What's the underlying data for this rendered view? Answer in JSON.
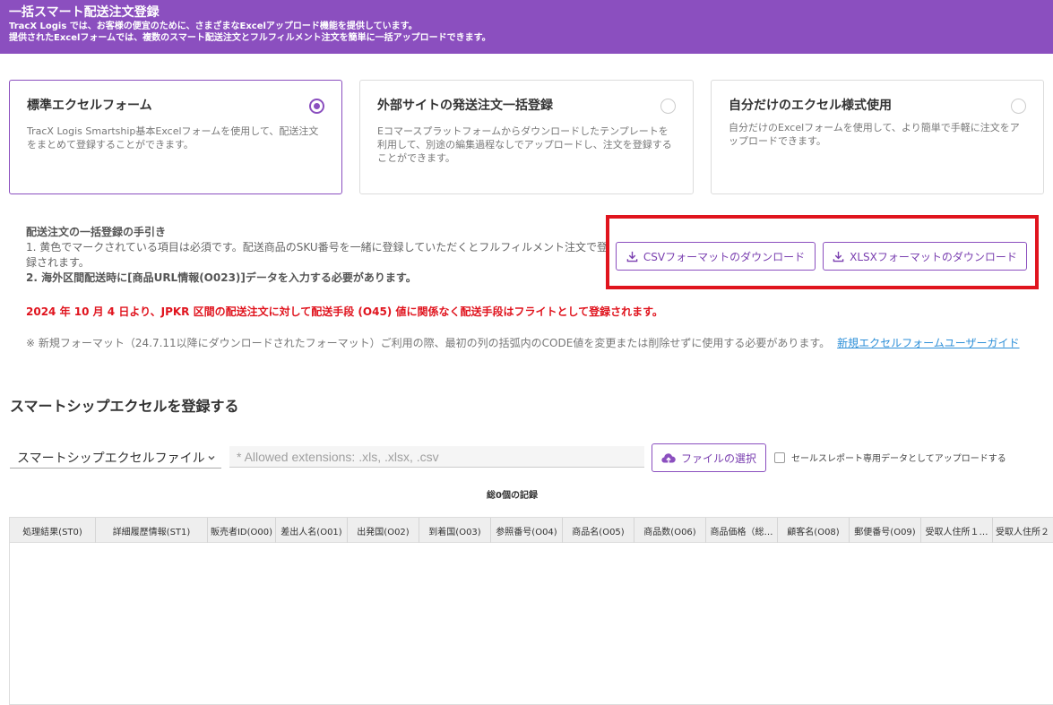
{
  "header": {
    "title": "一括スマート配送注文登録",
    "desc1": "TracX Logis では、お客様の便宜のために、さまざまなExcelアップロード機能を提供しています。",
    "desc2": "提供されたExcelフォームでは、複数のスマート配送注文とフルフィルメント注文を簡単に一括アップロードできます。"
  },
  "cards": [
    {
      "title": "標準エクセルフォーム",
      "desc": "TracX Logis Smartship基本Excelフォームを使用して、配送注文をまとめて登録することができます。",
      "selected": true
    },
    {
      "title": "外部サイトの発送注文一括登録",
      "desc": "Eコマースプラットフォームからダウンロードしたテンプレートを利用して、別途の編集過程なしでアップロードし、注文を登録することができます。",
      "selected": false
    },
    {
      "title": "自分だけのエクセル様式使用",
      "desc": "自分だけのExcelフォームを使用して、より簡単で手軽に注文をアップロードできます。",
      "selected": false
    }
  ],
  "guide": {
    "title": "配送注文の一括登録の手引き",
    "line1": "1. 黄色でマークされている項目は必須です。配送商品のSKU番号を一緒に登録していただくとフルフィルメント注文で登録されます。",
    "line2": "2. 海外区間配送時に[商品URL情報(O023)]データを入力する必要があります。"
  },
  "downloads": {
    "csv_label": "CSVフォーマットのダウンロード",
    "xlsx_label": "XLSXフォーマットのダウンロード"
  },
  "notice": "2024 年 10 月 4 日より、JPKR 区間の配送注文に対して配送手段 (O45) 値に関係なく配送手段はフライトとして登録されます。",
  "note": {
    "text": "※ 新規フォーマット（24.7.11以降にダウンロードされたフォーマット）ご利用の際、最初の列の括弧内のCODE値を変更または削除せずに使用する必要があります。",
    "link": "新規エクセルフォームユーザーガイド"
  },
  "upload": {
    "section_title": "スマートシップエクセルを登録する",
    "select_value": "スマートシップエクセルファイル",
    "file_placeholder": "* Allowed extensions: .xls, .xlsx, .csv",
    "file_button": "ファイルの選択",
    "checkbox_label": "セールスレポート専用データとしてアップロードする",
    "total": "総0個の記録"
  },
  "table": {
    "columns": [
      "処理結果(ST0)",
      "詳細履歴情報(ST1)",
      "販売者ID(O00)",
      "差出人名(O01)",
      "出発国(O02)",
      "到着国(O03)",
      "参照番号(O04)",
      "商品名(O05)",
      "商品数(O06)",
      "商品価格（総…",
      "顧客名(O08)",
      "郵便番号(O09)",
      "受取人住所１…",
      "受取人住所２"
    ]
  },
  "colors": {
    "accent": "#8b4fbf",
    "highlight": "#e0141e",
    "link": "#2d8fd8"
  },
  "icons": {
    "download": "download-icon",
    "upload": "cloud-upload-icon",
    "dropdown": "chevron-down-icon"
  }
}
